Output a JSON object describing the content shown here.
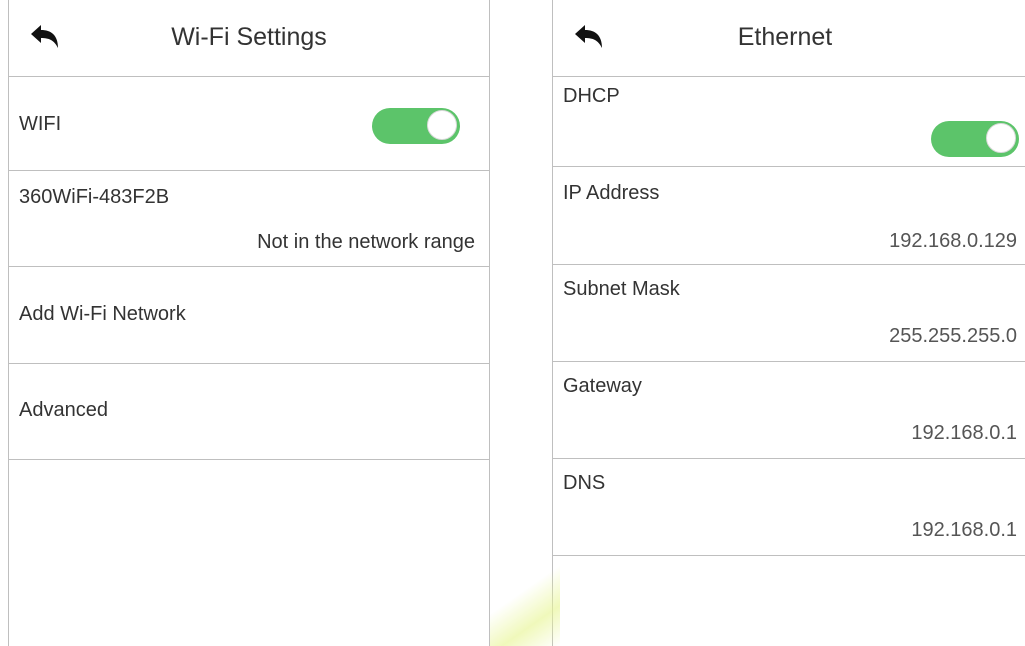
{
  "wifi_screen": {
    "title": "Wi-Fi Settings",
    "wifi_label": "WIFI",
    "wifi_enabled": true,
    "network": {
      "ssid": "360WiFi-483F2B",
      "status": "Not in the network range"
    },
    "add_network_label": "Add Wi-Fi Network",
    "advanced_label": "Advanced"
  },
  "ethernet_screen": {
    "title": "Ethernet",
    "dhcp_label": "DHCP",
    "dhcp_enabled": true,
    "fields": [
      {
        "label": "IP Address",
        "value": "192.168.0.129"
      },
      {
        "label": "Subnet Mask",
        "value": "255.255.255.0"
      },
      {
        "label": "Gateway",
        "value": "192.168.0.1"
      },
      {
        "label": "DNS",
        "value": "192.168.0.1"
      }
    ]
  },
  "colors": {
    "toggle_on": "#5cc46a",
    "divider": "#bfbfbf",
    "text": "#333333"
  },
  "icons": {
    "back": "back-arrow-icon"
  }
}
